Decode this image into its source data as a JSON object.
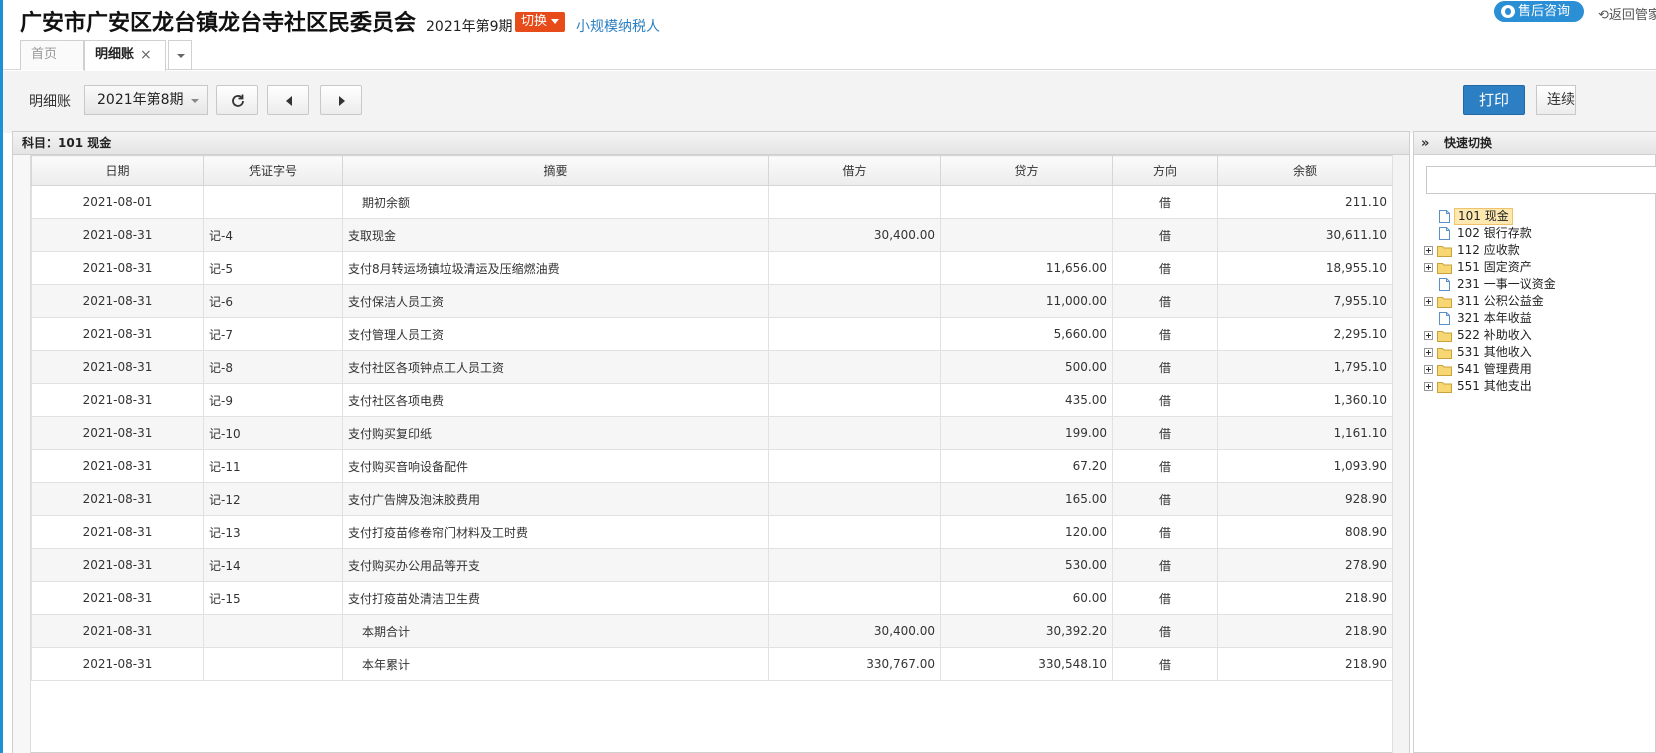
{
  "header": {
    "org_name": "广安市广安区龙台镇龙台寺社区民委员会",
    "period": "2021年第9期",
    "switch_label": "切换",
    "taxpayer_type": "小规模纳税人",
    "consult_label": "售后咨询",
    "back_label": "返回管家"
  },
  "tabs": {
    "home": "首页",
    "detail": "明细账",
    "close": "×"
  },
  "toolbar": {
    "label": "明细账",
    "period_select": "2021年第8期",
    "print_label": "打印",
    "continuous_label": "连续打印"
  },
  "ledger": {
    "subject": "科目：101  现金",
    "columns": [
      "日期",
      "凭证字号",
      "摘要",
      "借方",
      "贷方",
      "方向",
      "余额"
    ],
    "rows": [
      {
        "date": "2021-08-01",
        "voucher": "",
        "summary": "期初余额",
        "debit": "",
        "credit": "",
        "dir": "借",
        "balance": "211.10"
      },
      {
        "date": "2021-08-31",
        "voucher": "记-4",
        "summary": "支取现金",
        "debit": "30,400.00",
        "credit": "",
        "dir": "借",
        "balance": "30,611.10"
      },
      {
        "date": "2021-08-31",
        "voucher": "记-5",
        "summary": "支付8月转运场镇垃圾清运及压缩燃油费",
        "debit": "",
        "credit": "11,656.00",
        "dir": "借",
        "balance": "18,955.10"
      },
      {
        "date": "2021-08-31",
        "voucher": "记-6",
        "summary": "支付保洁人员工资",
        "debit": "",
        "credit": "11,000.00",
        "dir": "借",
        "balance": "7,955.10"
      },
      {
        "date": "2021-08-31",
        "voucher": "记-7",
        "summary": "支付管理人员工资",
        "debit": "",
        "credit": "5,660.00",
        "dir": "借",
        "balance": "2,295.10"
      },
      {
        "date": "2021-08-31",
        "voucher": "记-8",
        "summary": "支付社区各项钟点工人员工资",
        "debit": "",
        "credit": "500.00",
        "dir": "借",
        "balance": "1,795.10"
      },
      {
        "date": "2021-08-31",
        "voucher": "记-9",
        "summary": "支付社区各项电费",
        "debit": "",
        "credit": "435.00",
        "dir": "借",
        "balance": "1,360.10"
      },
      {
        "date": "2021-08-31",
        "voucher": "记-10",
        "summary": "支付购买复印纸",
        "debit": "",
        "credit": "199.00",
        "dir": "借",
        "balance": "1,161.10"
      },
      {
        "date": "2021-08-31",
        "voucher": "记-11",
        "summary": "支付购买音响设备配件",
        "debit": "",
        "credit": "67.20",
        "dir": "借",
        "balance": "1,093.90"
      },
      {
        "date": "2021-08-31",
        "voucher": "记-12",
        "summary": "支付广告牌及泡沫胶费用",
        "debit": "",
        "credit": "165.00",
        "dir": "借",
        "balance": "928.90"
      },
      {
        "date": "2021-08-31",
        "voucher": "记-13",
        "summary": "支付打疫苗修卷帘门材料及工时费",
        "debit": "",
        "credit": "120.00",
        "dir": "借",
        "balance": "808.90"
      },
      {
        "date": "2021-08-31",
        "voucher": "记-14",
        "summary": "支付购买办公用品等开支",
        "debit": "",
        "credit": "530.00",
        "dir": "借",
        "balance": "278.90"
      },
      {
        "date": "2021-08-31",
        "voucher": "记-15",
        "summary": "支付打疫苗处清洁卫生费",
        "debit": "",
        "credit": "60.00",
        "dir": "借",
        "balance": "218.90"
      },
      {
        "date": "2021-08-31",
        "voucher": "",
        "summary": "本期合计",
        "debit": "30,400.00",
        "credit": "30,392.20",
        "dir": "借",
        "balance": "218.90"
      },
      {
        "date": "2021-08-31",
        "voucher": "",
        "summary": "本年累计",
        "debit": "330,767.00",
        "credit": "330,548.10",
        "dir": "借",
        "balance": "218.90"
      }
    ]
  },
  "quick_switch": {
    "title": "快速切换",
    "collapse": "»",
    "items": [
      {
        "label": "101 现金",
        "type": "file",
        "expandable": false,
        "selected": true
      },
      {
        "label": "102 银行存款",
        "type": "file",
        "expandable": false,
        "selected": false
      },
      {
        "label": "112 应收款",
        "type": "folder",
        "expandable": true,
        "selected": false
      },
      {
        "label": "151 固定资产",
        "type": "folder",
        "expandable": true,
        "selected": false
      },
      {
        "label": "231 一事一议资金",
        "type": "file",
        "expandable": false,
        "selected": false
      },
      {
        "label": "311 公积公益金",
        "type": "folder",
        "expandable": true,
        "selected": false
      },
      {
        "label": "321 本年收益",
        "type": "file",
        "expandable": false,
        "selected": false
      },
      {
        "label": "522 补助收入",
        "type": "folder",
        "expandable": true,
        "selected": false
      },
      {
        "label": "531 其他收入",
        "type": "folder",
        "expandable": true,
        "selected": false
      },
      {
        "label": "541 管理费用",
        "type": "folder",
        "expandable": true,
        "selected": false
      },
      {
        "label": "551 其他支出",
        "type": "folder",
        "expandable": true,
        "selected": false
      }
    ]
  },
  "colors": {
    "accent": "#2b8fd6",
    "switch": "#e84b1a",
    "print": "#2d7fc4",
    "selected": "#fde9b0"
  }
}
